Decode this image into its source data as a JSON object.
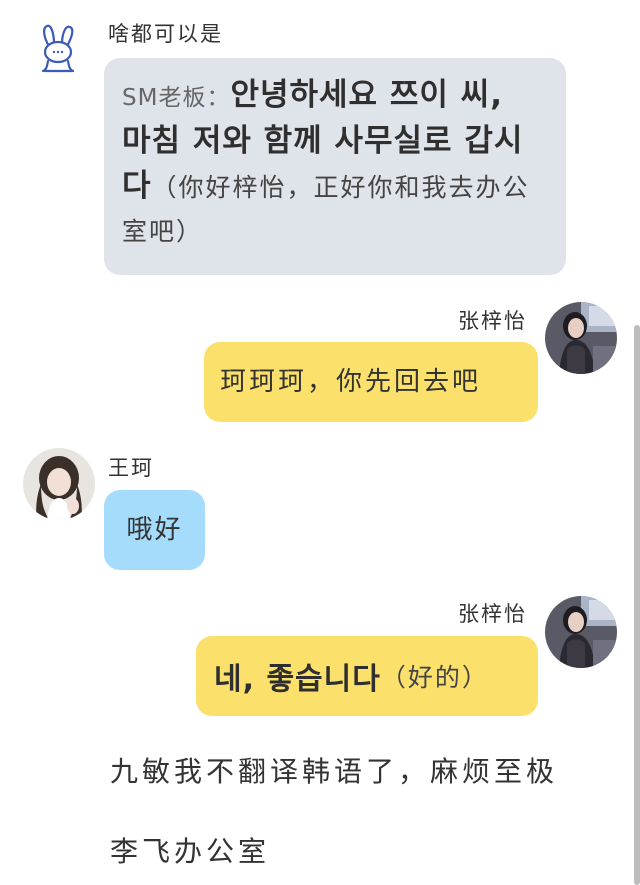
{
  "messages": [
    {
      "sender": "啥都可以是",
      "prefix": "SM老板：",
      "korean": "안녕하세요 쯔이 씨, 마침 저와 함께 사무실로 갑시다",
      "translation": "（你好梓怡，正好你和我去办公室吧）"
    },
    {
      "sender": "张梓怡",
      "text": "珂珂珂，你先回去吧"
    },
    {
      "sender": "王珂",
      "text": "哦好"
    },
    {
      "sender": "张梓怡",
      "korean": "네, 좋습니다",
      "translation": "（好的）"
    }
  ],
  "narration": [
    "九敏我不翻译韩语了，麻烦至极",
    "李飞办公室"
  ],
  "icons": {
    "bunny_avatar": "bunny-avatar-icon",
    "photo_avatar_zhang": "avatar-photo",
    "photo_avatar_wang": "avatar-photo"
  }
}
